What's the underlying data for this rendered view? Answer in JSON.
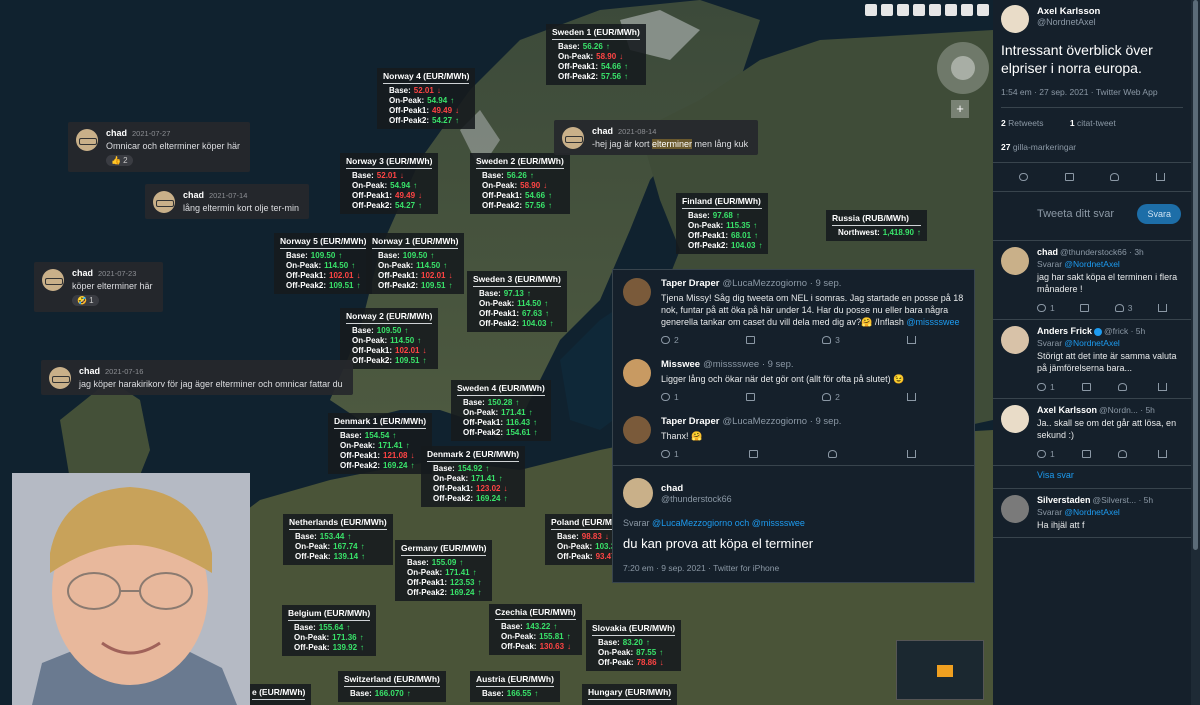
{
  "prices": [
    {
      "id": "sweden1",
      "title": "Sweden 1 (EUR/MWh)",
      "rows": [
        [
          "Base:",
          "56.26",
          "up"
        ],
        [
          "On-Peak:",
          "58.90",
          "dn"
        ],
        [
          "Off-Peak1:",
          "54.66",
          "up"
        ],
        [
          "Off-Peak2:",
          "57.56",
          "up"
        ]
      ]
    },
    {
      "id": "norway4",
      "title": "Norway 4 (EUR/MWh)",
      "rows": [
        [
          "Base:",
          "52.01",
          "dn"
        ],
        [
          "On-Peak:",
          "54.94",
          "up"
        ],
        [
          "Off-Peak1:",
          "49.49",
          "dn"
        ],
        [
          "Off-Peak2:",
          "54.27",
          "up"
        ]
      ]
    },
    {
      "id": "norway3",
      "title": "Norway 3 (EUR/MWh)",
      "rows": [
        [
          "Base:",
          "52.01",
          "dn"
        ],
        [
          "On-Peak:",
          "54.94",
          "up"
        ],
        [
          "Off-Peak1:",
          "49.49",
          "dn"
        ],
        [
          "Off-Peak2:",
          "54.27",
          "up"
        ]
      ]
    },
    {
      "id": "sweden2",
      "title": "Sweden 2 (EUR/MWh)",
      "rows": [
        [
          "Base:",
          "56.26",
          "up"
        ],
        [
          "On-Peak:",
          "58.90",
          "dn"
        ],
        [
          "Off-Peak1:",
          "54.66",
          "up"
        ],
        [
          "Off-Peak2:",
          "57.56",
          "up"
        ]
      ]
    },
    {
      "id": "finland",
      "title": "Finland (EUR/MWh)",
      "rows": [
        [
          "Base:",
          "97.68",
          "up"
        ],
        [
          "On-Peak:",
          "115.35",
          "up"
        ],
        [
          "Off-Peak1:",
          "68.01",
          "up"
        ],
        [
          "Off-Peak2:",
          "104.03",
          "up"
        ]
      ]
    },
    {
      "id": "russia",
      "title": "Russia (RUB/MWh)",
      "rows": [
        [
          "Northwest:",
          "1,418.90",
          "up"
        ]
      ]
    },
    {
      "id": "norway5",
      "title": "Norway 5 (EUR/MWh)",
      "rows": [
        [
          "Base:",
          "109.50",
          "up"
        ],
        [
          "On-Peak:",
          "114.50",
          "up"
        ],
        [
          "Off-Peak1:",
          "102.01",
          "dn"
        ],
        [
          "Off-Peak2:",
          "109.51",
          "up"
        ]
      ]
    },
    {
      "id": "norway1",
      "title": "Norway 1 (EUR/MWh)",
      "rows": [
        [
          "Base:",
          "109.50",
          "up"
        ],
        [
          "On-Peak:",
          "114.50",
          "up"
        ],
        [
          "Off-Peak1:",
          "102.01",
          "dn"
        ],
        [
          "Off-Peak2:",
          "109.51",
          "up"
        ]
      ]
    },
    {
      "id": "sweden3",
      "title": "Sweden 3 (EUR/MWh)",
      "rows": [
        [
          "Base:",
          "97.13",
          "up"
        ],
        [
          "On-Peak:",
          "114.50",
          "up"
        ],
        [
          "Off-Peak1:",
          "67.63",
          "up"
        ],
        [
          "Off-Peak2:",
          "104.03",
          "up"
        ]
      ]
    },
    {
      "id": "norway2",
      "title": "Norway 2 (EUR/MWh)",
      "rows": [
        [
          "Base:",
          "109.50",
          "up"
        ],
        [
          "On-Peak:",
          "114.50",
          "up"
        ],
        [
          "Off-Peak1:",
          "102.01",
          "dn"
        ],
        [
          "Off-Peak2:",
          "109.51",
          "up"
        ]
      ]
    },
    {
      "id": "sweden4",
      "title": "Sweden 4 (EUR/MWh)",
      "rows": [
        [
          "Base:",
          "150.28",
          "up"
        ],
        [
          "On-Peak:",
          "171.41",
          "up"
        ],
        [
          "Off-Peak1:",
          "116.43",
          "up"
        ],
        [
          "Off-Peak2:",
          "154.61",
          "up"
        ]
      ]
    },
    {
      "id": "denmark1",
      "title": "Denmark 1 (EUR/MWh)",
      "rows": [
        [
          "Base:",
          "154.54",
          "up"
        ],
        [
          "On-Peak:",
          "171.41",
          "up"
        ],
        [
          "Off-Peak1:",
          "121.08",
          "dn"
        ],
        [
          "Off-Peak2:",
          "169.24",
          "up"
        ]
      ]
    },
    {
      "id": "denmark2",
      "title": "Denmark 2 (EUR/MWh)",
      "rows": [
        [
          "Base:",
          "154.92",
          "up"
        ],
        [
          "On-Peak:",
          "171.41",
          "up"
        ],
        [
          "Off-Peak1:",
          "123.02",
          "dn"
        ],
        [
          "Off-Peak2:",
          "169.24",
          "up"
        ]
      ]
    },
    {
      "id": "netherlands",
      "title": "Netherlands (EUR/MWh)",
      "rows": [
        [
          "Base:",
          "153.44",
          "up"
        ],
        [
          "On-Peak:",
          "167.74",
          "up"
        ],
        [
          "Off-Peak:",
          "139.14",
          "up"
        ]
      ]
    },
    {
      "id": "germany",
      "title": "Germany (EUR/MWh)",
      "rows": [
        [
          "Base:",
          "155.09",
          "up"
        ],
        [
          "On-Peak:",
          "171.41",
          "up"
        ],
        [
          "Off-Peak1:",
          "123.53",
          "up"
        ],
        [
          "Off-Peak2:",
          "169.24",
          "up"
        ]
      ]
    },
    {
      "id": "poland",
      "title": "Poland (EUR/MWh)",
      "rows": [
        [
          "Base:",
          "98.83",
          "dn"
        ],
        [
          "On-Peak:",
          "103.3",
          "up"
        ],
        [
          "Off-Peak:",
          "93.47",
          "dn"
        ]
      ]
    },
    {
      "id": "belgium",
      "title": "Belgium (EUR/MWh)",
      "rows": [
        [
          "Base:",
          "155.64",
          "up"
        ],
        [
          "On-Peak:",
          "171.36",
          "up"
        ],
        [
          "Off-Peak:",
          "139.92",
          "up"
        ]
      ]
    },
    {
      "id": "czechia",
      "title": "Czechia (EUR/MWh)",
      "rows": [
        [
          "Base:",
          "143.22",
          "up"
        ],
        [
          "On-Peak:",
          "155.81",
          "up"
        ],
        [
          "Off-Peak:",
          "130.63",
          "dn"
        ]
      ]
    },
    {
      "id": "slovakia",
      "title": "Slovakia (EUR/MWh)",
      "rows": [
        [
          "Base:",
          "83.20",
          "up"
        ],
        [
          "On-Peak:",
          "87.55",
          "up"
        ],
        [
          "Off-Peak:",
          "78.86",
          "dn"
        ]
      ]
    },
    {
      "id": "switzerland",
      "title": "Switzerland (EUR/MWh)",
      "rows": [
        [
          "Base:",
          "166.070",
          "up"
        ]
      ]
    },
    {
      "id": "austria",
      "title": "Austria (EUR/MWh)",
      "rows": [
        [
          "Base:",
          "166.55",
          "up"
        ]
      ]
    },
    {
      "id": "hungary",
      "title": "Hungary (EUR/MWh)",
      "rows": []
    },
    {
      "id": "france",
      "title": "e (EUR/MWh)",
      "rows": []
    }
  ],
  "arrows": {
    "up": "↑",
    "dn": "↓"
  },
  "chats": [
    {
      "name": "chad",
      "date": "2021-07-27",
      "msg": "Omnicar och elterminer köper här",
      "react": "👍 2"
    },
    {
      "name": "chad",
      "date": "2021-07-14",
      "msg": "lång eltermin kort olje ter-min",
      "react": ""
    },
    {
      "name": "chad",
      "date": "2021-07-23",
      "msg": "köper elterminer här",
      "react": "🤣 1"
    },
    {
      "name": "chad",
      "date": "2021-07-16",
      "msg": "jag köper harakirikorv för jag äger elterminer och omnicar fattar du",
      "react": ""
    },
    {
      "name": "chad",
      "date": "2021-08-14",
      "msg_pre": "-hej jag är kort ",
      "msg_hl": "elterminer",
      "msg_post": " men lång kuk",
      "react": ""
    }
  ],
  "thread": {
    "t1": {
      "name": "Taper Draper",
      "handle": "@LucaMezzogiorno · 9 sep.",
      "text": "Tjena Missy! Såg dig tweeta om NEL i somras. Jag startade en posse på 18 nok, funtar på att öka på här under 14. Har du posse nu eller bara några generella tankar om caset du vill dela med dig av?🤗 /Inflash ",
      "mention": "@misssswee",
      "replies": "2",
      "likes": "3"
    },
    "t2": {
      "name": "Misswee",
      "handle": "@misssswee · 9 sep.",
      "text": "Ligger lång och ökar när det gör ont (allt för ofta på slutet) 😉",
      "replies": "1",
      "likes": "2"
    },
    "t3": {
      "name": "Taper Draper",
      "handle": "@LucaMezzogiorno · 9 sep.",
      "text": "Thanx! 🤗",
      "replies": "1",
      "likes": ""
    },
    "focus": {
      "name": "chad",
      "handle": "@thunderstock66",
      "reply_prefix": "Svarar ",
      "reply_to": "@LucaMezzogiorno och @misssswee",
      "text": "du kan prova att köpa el terminer",
      "time": "7:20 em · 9 sep. 2021 · Twitter for iPhone"
    }
  },
  "side": {
    "name": "Axel Karlsson",
    "handle": "@NordnetAxel",
    "text": "Intressant överblick över elpriser i norra europa.",
    "time": "1:54 em · 27 sep. 2021 · Twitter Web App",
    "retweets_n": "2",
    "retweets_l": "Retweets",
    "quotes_n": "1",
    "quotes_l": "citat-tweet",
    "likes_n": "27",
    "likes_l": "gilla-markeringar",
    "placeholder": "Tweeta ditt svar",
    "reply_btn": "Svara",
    "replies": [
      {
        "name": "chad",
        "handle": "@thunderstock66 · 3h",
        "sv": "Svarar ",
        "to": "@NordnetAxel",
        "text": "jag har sakt köpa el terminen i flera månadere !",
        "r": "1",
        "l": "3",
        "verified": false
      },
      {
        "name": "Anders Frick",
        "handle": "@frick · 5h",
        "sv": "Svarar ",
        "to": "@NordnetAxel",
        "text": "Störigt att det inte är samma valuta på jämförelserna bara...",
        "r": "1",
        "l": "",
        "verified": true
      },
      {
        "name": "Axel Karlsson",
        "handle": "@Nordn... · 5h",
        "sv": "",
        "to": "",
        "text": "Ja.. skall se om det går att lösa, en sekund :)",
        "r": "1",
        "l": "",
        "verified": false
      }
    ],
    "show_replies": "Visa svar",
    "last": {
      "name": "Silverstaden",
      "handle": "@Silverst... · 5h",
      "sv": "Svarar ",
      "to": "@NordnetAxel",
      "text": "Ha ihjäl att f"
    }
  }
}
